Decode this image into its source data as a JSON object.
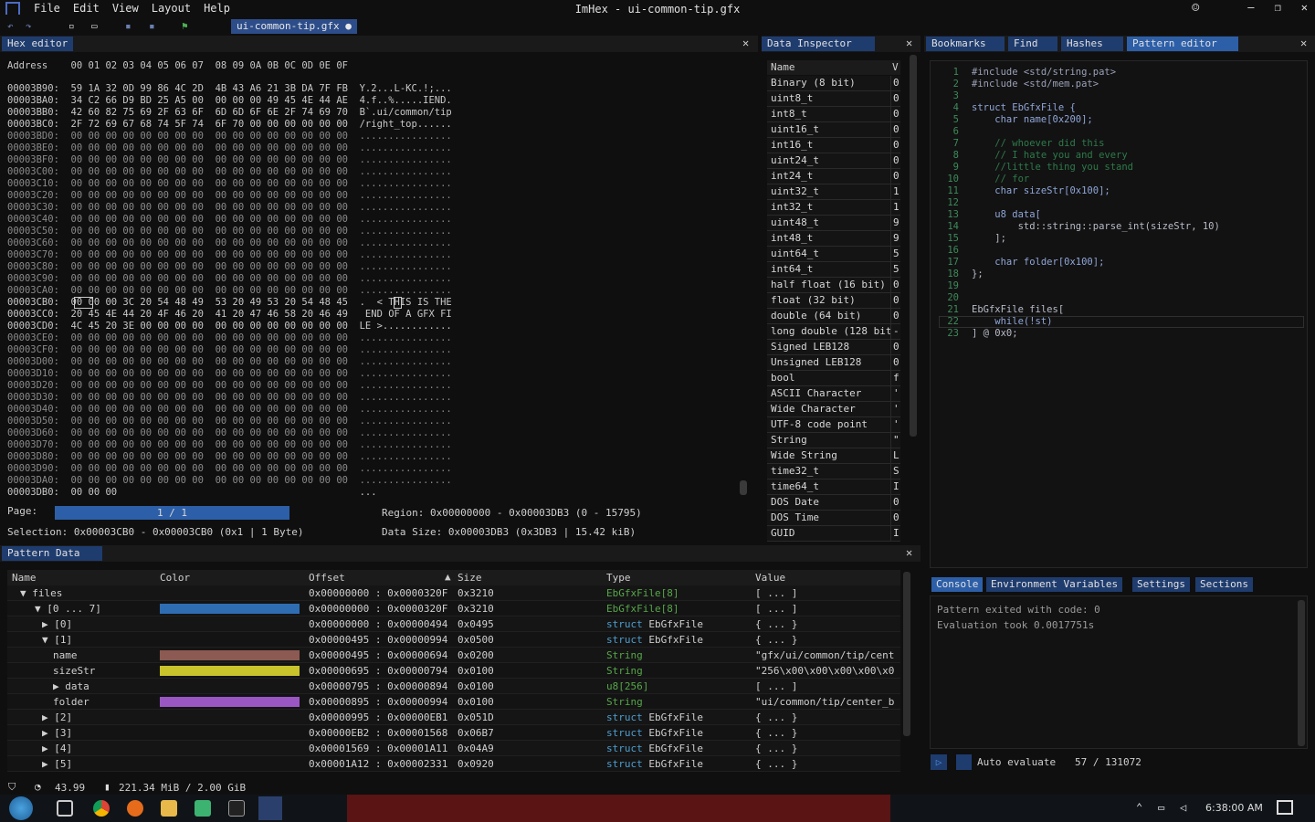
{
  "window": {
    "menu": [
      "File",
      "Edit",
      "View",
      "Layout",
      "Help"
    ],
    "title": "ImHex - ui-common-tip.gfx",
    "buttons": [
      "—",
      "❐",
      "✕"
    ],
    "smile": "☺"
  },
  "file_tab": {
    "label": "ui-common-tip.gfx ●"
  },
  "hex_editor": {
    "tab": "Hex editor",
    "header": "Address    00 01 02 03 04 05 06 07  08 09 0A 0B 0C 0D 0E 0F",
    "rows": [
      "00003B90:  59 1A 32 0D 99 86 4C 2D  4B 43 A6 21 3B DA 7F FB  Y.2...L-KC.!;...",
      "00003BA0:  34 C2 66 D9 BD 25 A5 00  00 00 00 49 45 4E 44 AE  4.f..%.....IEND.",
      "00003BB0:  42 60 82 75 69 2F 63 6F  6D 6D 6F 6E 2F 74 69 70  B`.ui/common/tip",
      "00003BC0:  2F 72 69 67 68 74 5F 74  6F 70 00 00 00 00 00 00  /right_top......",
      "00003BD0:  00 00 00 00 00 00 00 00  00 00 00 00 00 00 00 00  ................",
      "00003BE0:  00 00 00 00 00 00 00 00  00 00 00 00 00 00 00 00  ................",
      "00003BF0:  00 00 00 00 00 00 00 00  00 00 00 00 00 00 00 00  ................",
      "00003C00:  00 00 00 00 00 00 00 00  00 00 00 00 00 00 00 00  ................",
      "00003C10:  00 00 00 00 00 00 00 00  00 00 00 00 00 00 00 00  ................",
      "00003C20:  00 00 00 00 00 00 00 00  00 00 00 00 00 00 00 00  ................",
      "00003C30:  00 00 00 00 00 00 00 00  00 00 00 00 00 00 00 00  ................",
      "00003C40:  00 00 00 00 00 00 00 00  00 00 00 00 00 00 00 00  ................",
      "00003C50:  00 00 00 00 00 00 00 00  00 00 00 00 00 00 00 00  ................",
      "00003C60:  00 00 00 00 00 00 00 00  00 00 00 00 00 00 00 00  ................",
      "00003C70:  00 00 00 00 00 00 00 00  00 00 00 00 00 00 00 00  ................",
      "00003C80:  00 00 00 00 00 00 00 00  00 00 00 00 00 00 00 00  ................",
      "00003C90:  00 00 00 00 00 00 00 00  00 00 00 00 00 00 00 00  ................",
      "00003CA0:  00 00 00 00 00 00 00 00  00 00 00 00 00 00 00 00  ................",
      "00003CB0:  00 00 00 3C 20 54 48 49  53 20 49 53 20 54 48 45  .  < THIS IS THE",
      "00003CC0:  20 45 4E 44 20 4F 46 20  41 20 47 46 58 20 46 49   END OF A GFX FI",
      "00003CD0:  4C 45 20 3E 00 00 00 00  00 00 00 00 00 00 00 00  LE >............",
      "00003CE0:  00 00 00 00 00 00 00 00  00 00 00 00 00 00 00 00  ................",
      "00003CF0:  00 00 00 00 00 00 00 00  00 00 00 00 00 00 00 00  ................",
      "00003D00:  00 00 00 00 00 00 00 00  00 00 00 00 00 00 00 00  ................",
      "00003D10:  00 00 00 00 00 00 00 00  00 00 00 00 00 00 00 00  ................",
      "00003D20:  00 00 00 00 00 00 00 00  00 00 00 00 00 00 00 00  ................",
      "00003D30:  00 00 00 00 00 00 00 00  00 00 00 00 00 00 00 00  ................",
      "00003D40:  00 00 00 00 00 00 00 00  00 00 00 00 00 00 00 00  ................",
      "00003D50:  00 00 00 00 00 00 00 00  00 00 00 00 00 00 00 00  ................",
      "00003D60:  00 00 00 00 00 00 00 00  00 00 00 00 00 00 00 00  ................",
      "00003D70:  00 00 00 00 00 00 00 00  00 00 00 00 00 00 00 00  ................",
      "00003D80:  00 00 00 00 00 00 00 00  00 00 00 00 00 00 00 00  ................",
      "00003D90:  00 00 00 00 00 00 00 00  00 00 00 00 00 00 00 00  ................",
      "00003DA0:  00 00 00 00 00 00 00 00  00 00 00 00 00 00 00 00  ................",
      "00003DB0:  00 00 00                                          ..."
    ],
    "page_label": "Page:",
    "page_value": "1 / 1",
    "region": "Region: 0x00000000 - 0x00003DB3 (0 - 15795)",
    "selection": "Selection: 0x00003CB0 - 0x00003CB0 (0x1 | 1 Byte)",
    "data_size": "Data Size: 0x00003DB3 (0x3DB3 | 15.42 kiB)"
  },
  "data_inspector": {
    "tab": "Data Inspector",
    "col_name": "Name",
    "col_value": "V",
    "rows": [
      {
        "name": "Binary (8 bit)",
        "value": "0"
      },
      {
        "name": "uint8_t",
        "value": "0"
      },
      {
        "name": "int8_t",
        "value": "0"
      },
      {
        "name": "uint16_t",
        "value": "0"
      },
      {
        "name": "int16_t",
        "value": "0"
      },
      {
        "name": "uint24_t",
        "value": "0"
      },
      {
        "name": "int24_t",
        "value": "0"
      },
      {
        "name": "uint32_t",
        "value": "1"
      },
      {
        "name": "int32_t",
        "value": "1"
      },
      {
        "name": "uint48_t",
        "value": "9"
      },
      {
        "name": "int48_t",
        "value": "9"
      },
      {
        "name": "uint64_t",
        "value": "5"
      },
      {
        "name": "int64_t",
        "value": "5"
      },
      {
        "name": "half float (16 bit)",
        "value": "0"
      },
      {
        "name": "float (32 bit)",
        "value": "0"
      },
      {
        "name": "double (64 bit)",
        "value": "0"
      },
      {
        "name": "long double (128 bit)",
        "value": "-"
      },
      {
        "name": "Signed LEB128",
        "value": "0"
      },
      {
        "name": "Unsigned LEB128",
        "value": "0"
      },
      {
        "name": "bool",
        "value": "f"
      },
      {
        "name": "ASCII Character",
        "value": "'"
      },
      {
        "name": "Wide Character",
        "value": "'"
      },
      {
        "name": "UTF-8 code point",
        "value": "'"
      },
      {
        "name": "String",
        "value": "\""
      },
      {
        "name": "Wide String",
        "value": "L"
      },
      {
        "name": "time32_t",
        "value": "S"
      },
      {
        "name": "time64_t",
        "value": "I"
      },
      {
        "name": "DOS Date",
        "value": "0"
      },
      {
        "name": "DOS Time",
        "value": "0"
      },
      {
        "name": "GUID",
        "value": "I"
      }
    ]
  },
  "right_tabs": [
    "Bookmarks",
    "Find",
    "Hashes",
    "Pattern editor"
  ],
  "pattern_editor": {
    "lines": [
      "#include <std/string.pat>",
      "#include <std/mem.pat>",
      "",
      "struct EbGfxFile {",
      "    char name[0x200];",
      "",
      "    // whoever did this",
      "    // I hate you and every",
      "    //little thing you stand",
      "    // for",
      "    char sizeStr[0x100];",
      "",
      "    u8 data[",
      "        std::string::parse_int(sizeStr, 10)",
      "    ];",
      "",
      "    char folder[0x100];",
      "};",
      "",
      "",
      "EbGfxFile files[",
      "    while(!st)",
      "] @ 0x0;"
    ]
  },
  "console": {
    "tabs": [
      "Console",
      "Environment Variables",
      "Settings",
      "Sections"
    ],
    "lines": [
      "Pattern exited with code: 0",
      "Evaluation took 0.0017751s"
    ],
    "auto_evaluate": "Auto evaluate",
    "position": "57 / 131072"
  },
  "pattern_data": {
    "tab": "Pattern Data",
    "columns": [
      "Name",
      "Color",
      "Offset",
      "Size",
      "Type",
      "Value"
    ],
    "rows": [
      {
        "name": "▼ files",
        "color": "",
        "offset": "0x00000000 : 0x0000320F",
        "size": "0x3210",
        "type": "EbGfxFile[8]",
        "value": "[ ... ]"
      },
      {
        "name": "▼ [0 ... 7]",
        "color": "#2f6db3",
        "offset": "0x00000000 : 0x0000320F",
        "size": "0x3210",
        "type": "EbGfxFile[8]",
        "value": "[ ... ]"
      },
      {
        "name": "▶ [0]",
        "color": "",
        "offset": "0x00000000 : 0x00000494",
        "size": "0x0495",
        "type": "struct EbGfxFile",
        "value": "{ ... }"
      },
      {
        "name": "▼ [1]",
        "color": "",
        "offset": "0x00000495 : 0x00000994",
        "size": "0x0500",
        "type": "struct EbGfxFile",
        "value": "{ ... }"
      },
      {
        "name": "name",
        "color": "#8c5a52",
        "offset": "0x00000495 : 0x00000694",
        "size": "0x0200",
        "type": "String",
        "value": "\"gfx/ui/common/tip/cent"
      },
      {
        "name": "sizeStr",
        "color": "#c9c32c",
        "offset": "0x00000695 : 0x00000794",
        "size": "0x0100",
        "type": "String",
        "value": "\"256\\x00\\x00\\x00\\x00\\x0"
      },
      {
        "name": "▶ data",
        "color": "",
        "offset": "0x00000795 : 0x00000894",
        "size": "0x0100",
        "type": "u8[256]",
        "value": "[ ... ]"
      },
      {
        "name": "folder",
        "color": "#9a57c4",
        "offset": "0x00000895 : 0x00000994",
        "size": "0x0100",
        "type": "String",
        "value": "\"ui/common/tip/center_b"
      },
      {
        "name": "▶ [2]",
        "color": "",
        "offset": "0x00000995 : 0x00000EB1",
        "size": "0x051D",
        "type": "struct EbGfxFile",
        "value": "{ ... }"
      },
      {
        "name": "▶ [3]",
        "color": "",
        "offset": "0x00000EB2 : 0x00001568",
        "size": "0x06B7",
        "type": "struct EbGfxFile",
        "value": "{ ... }"
      },
      {
        "name": "▶ [4]",
        "color": "",
        "offset": "0x00001569 : 0x00001A11",
        "size": "0x04A9",
        "type": "struct EbGfxFile",
        "value": "{ ... }"
      },
      {
        "name": "▶ [5]",
        "color": "",
        "offset": "0x00001A12 : 0x00002331",
        "size": "0x0920",
        "type": "struct EbGfxFile",
        "value": "{ ... }"
      }
    ]
  },
  "statusbar": {
    "fps": "43.99",
    "memory": "221.34 MiB / 2.00 GiB"
  },
  "taskbar": {
    "clock": "6:38:00 AM"
  }
}
